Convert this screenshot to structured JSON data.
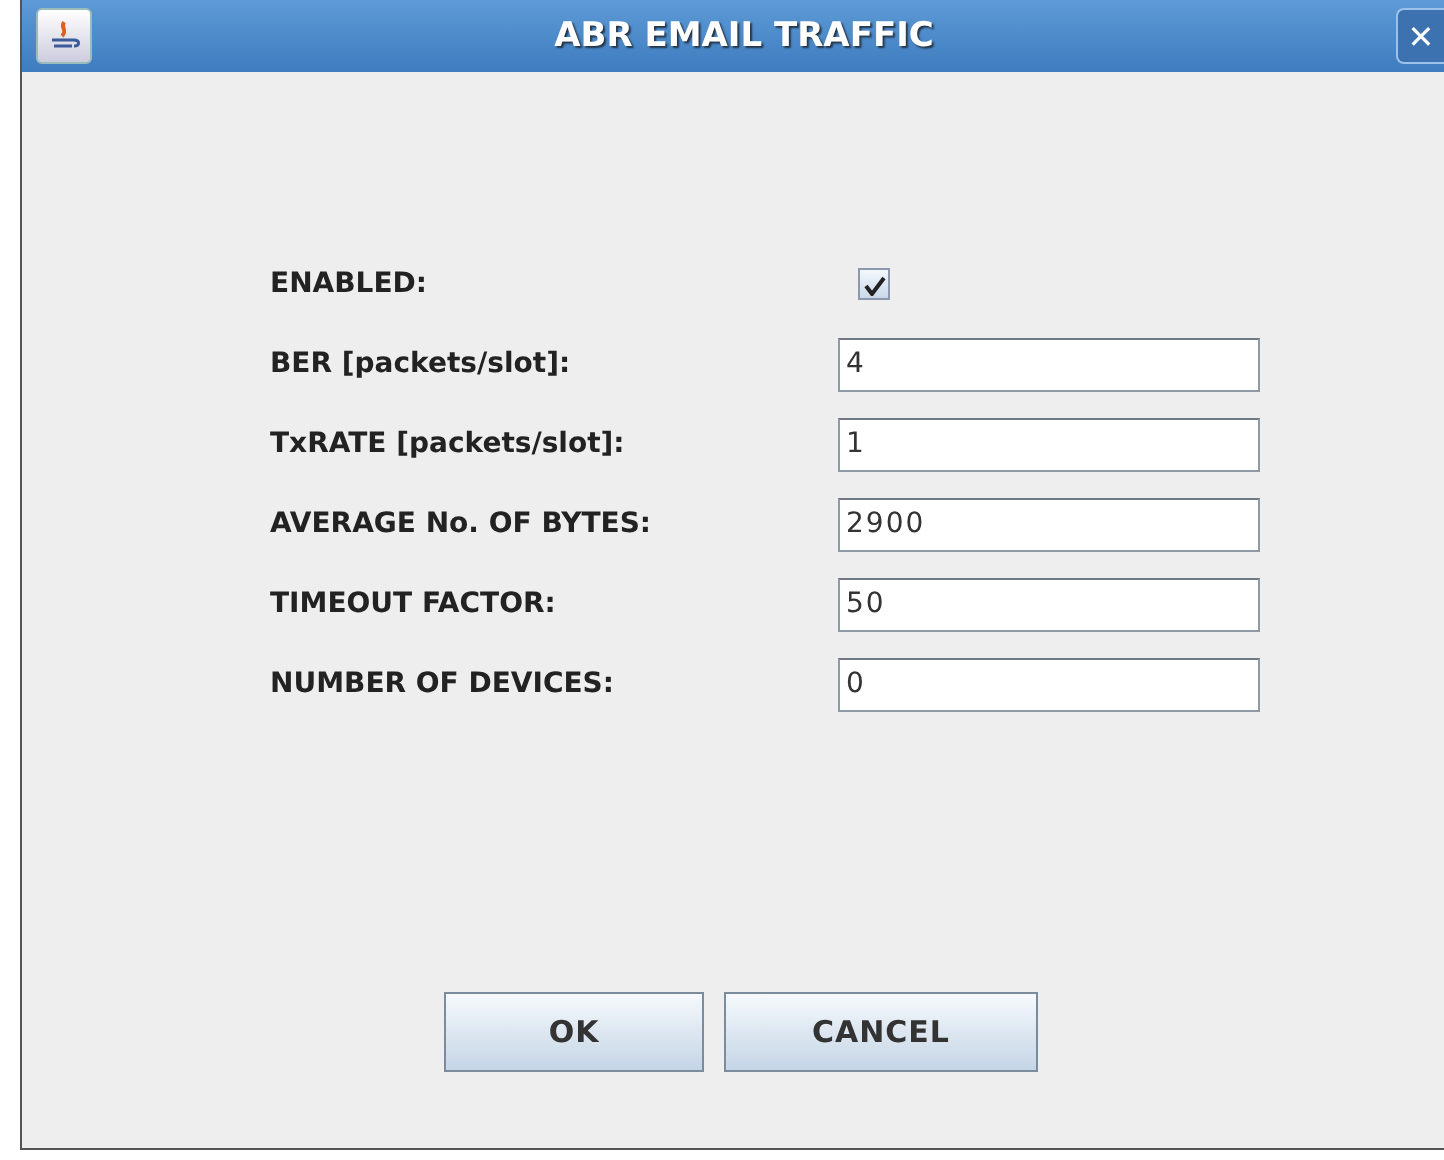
{
  "window": {
    "title": "ABR EMAIL TRAFFIC",
    "close": "✕"
  },
  "fields": [
    {
      "kind": "checkbox",
      "label": "ENABLED:",
      "checked": true
    },
    {
      "kind": "text",
      "label": "BER [packets/slot]:",
      "value": "4"
    },
    {
      "kind": "text",
      "label": "TxRATE [packets/slot]:",
      "value": "1"
    },
    {
      "kind": "text",
      "label": "AVERAGE No. OF BYTES:",
      "value": "2900"
    },
    {
      "kind": "text",
      "label": "TIMEOUT FACTOR:",
      "value": "50"
    },
    {
      "kind": "text",
      "label": "NUMBER OF DEVICES:",
      "value": "0"
    }
  ],
  "buttons": [
    "OK",
    "CANCEL"
  ]
}
